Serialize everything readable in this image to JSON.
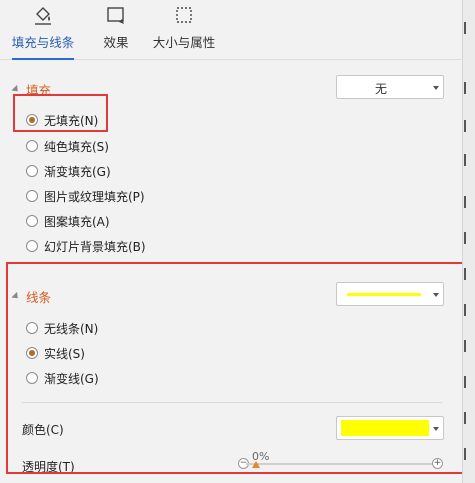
{
  "tabs": [
    {
      "label": "填充与线条",
      "icon": "fill-bucket-icon",
      "active": true
    },
    {
      "label": "效果",
      "icon": "effects-icon",
      "active": false
    },
    {
      "label": "大小与属性",
      "icon": "size-properties-icon",
      "active": false
    }
  ],
  "fill": {
    "title": "填充",
    "dropdown_value": "无",
    "options": [
      {
        "label": "无填充(N)",
        "checked": true
      },
      {
        "label": "纯色填充(S)",
        "checked": false
      },
      {
        "label": "渐变填充(G)",
        "checked": false
      },
      {
        "label": "图片或纹理填充(P)",
        "checked": false
      },
      {
        "label": "图案填充(A)",
        "checked": false
      },
      {
        "label": "幻灯片背景填充(B)",
        "checked": false
      }
    ]
  },
  "line": {
    "title": "线条",
    "line_color": "#ffff00",
    "options": [
      {
        "label": "无线条(N)",
        "checked": false
      },
      {
        "label": "实线(S)",
        "checked": true
      },
      {
        "label": "渐变线(G)",
        "checked": false
      }
    ],
    "color_label": "颜色(C)",
    "color_value": "#ffff00",
    "transparency_label": "透明度(T)",
    "transparency_value": "0%",
    "transparency_fraction": 0
  },
  "colors": {
    "accent": "#d35b1e",
    "highlight_box": "#e23a3a",
    "active_tab": "#2a6bd1"
  }
}
